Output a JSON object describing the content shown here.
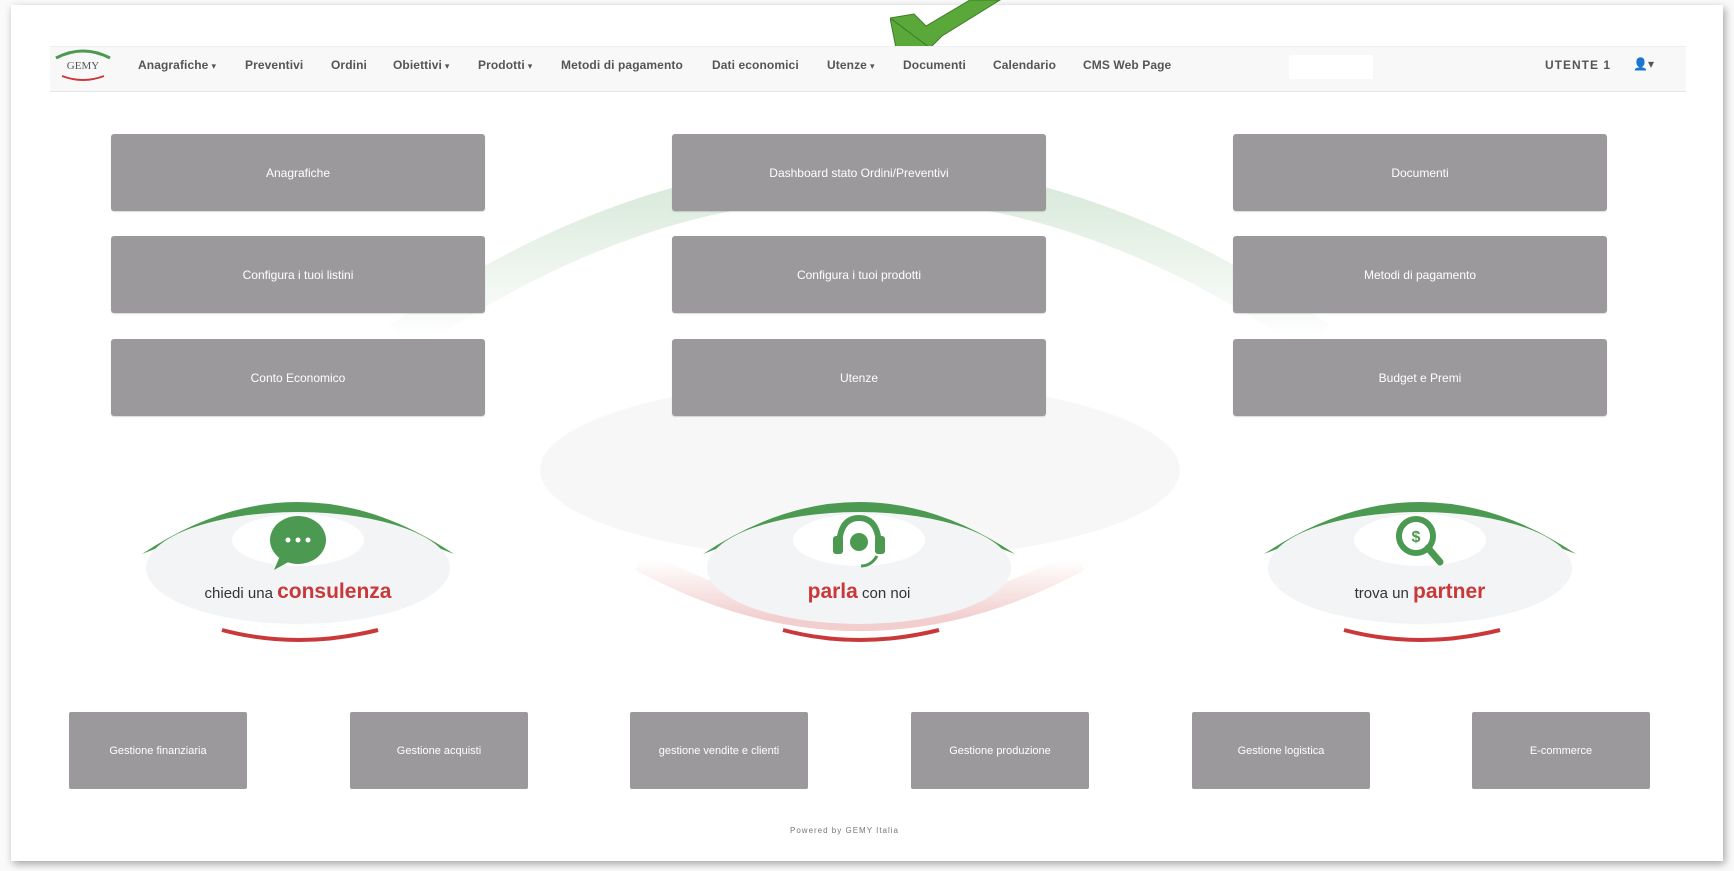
{
  "brand": {
    "logo_text": "GEMY"
  },
  "nav": {
    "items": [
      {
        "label": "Anagrafiche",
        "dropdown": true
      },
      {
        "label": "Preventivi",
        "dropdown": false
      },
      {
        "label": "Ordini",
        "dropdown": false
      },
      {
        "label": "Obiettivi",
        "dropdown": true
      },
      {
        "label": "Prodotti",
        "dropdown": true
      },
      {
        "label": "Metodi di pagamento",
        "dropdown": false
      },
      {
        "label": "Dati economici",
        "dropdown": false
      },
      {
        "label": "Utenze",
        "dropdown": true
      },
      {
        "label": "Documenti",
        "dropdown": false
      },
      {
        "label": "Calendario",
        "dropdown": false
      },
      {
        "label": "CMS Web Page",
        "dropdown": false
      }
    ],
    "caret": "▾",
    "user_label": "UTENTE 1",
    "user_icon": "user-icon"
  },
  "tiles": [
    "Anagrafiche",
    "Dashboard stato Ordini/Preventivi",
    "Documenti",
    "Configura i tuoi listini",
    "Configura i tuoi prodotti",
    "Metodi di pagamento",
    "Conto Economico",
    "Utenze",
    "Budget e Premi"
  ],
  "badges": [
    {
      "prefix": "chiedi una ",
      "strong": "consulenza",
      "suffix": "",
      "icon": "chat-bubble-icon"
    },
    {
      "prefix": "",
      "strong": "parla",
      "suffix": " con noi",
      "icon": "headset-icon"
    },
    {
      "prefix": "trova un ",
      "strong": "partner",
      "suffix": "",
      "icon": "search-dollar-icon"
    }
  ],
  "bottom_tiles": [
    "Gestione finanziaria",
    "Gestione acquisti",
    "gestione vendite e clienti",
    "Gestione produzione",
    "Gestione logistica",
    "E-commerce"
  ],
  "colors": {
    "tile_bg": "#9b999c",
    "green": "#4c9a52",
    "red": "#c9393a",
    "arrow": "#5aa83a"
  },
  "footer": {
    "text": "Powered by GEMY Italia"
  }
}
